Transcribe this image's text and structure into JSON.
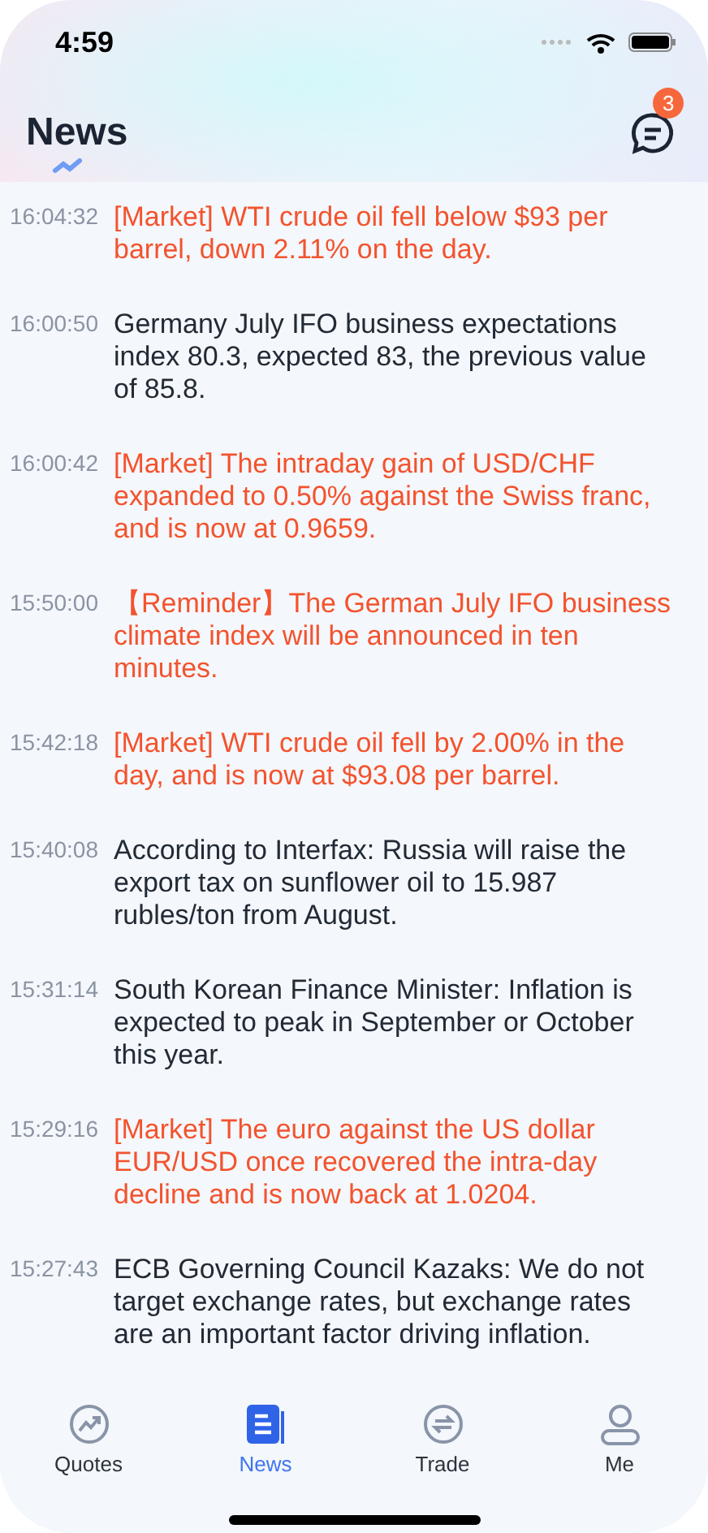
{
  "status_bar": {
    "time": "4:59"
  },
  "header": {
    "title": "News",
    "badge": "3"
  },
  "news": [
    {
      "time": "16:04:32",
      "text": "[Market] WTI crude oil fell below $93 per barrel, down 2.11% on the day.",
      "highlight": true
    },
    {
      "time": "16:00:50",
      "text": "Germany July IFO business expectations index 80.3, expected 83, the previous value of 85.8.",
      "highlight": false
    },
    {
      "time": "16:00:42",
      "text": "[Market] The intraday gain of USD/CHF expanded to 0.50% against the Swiss franc, and is now at 0.9659.",
      "highlight": true
    },
    {
      "time": "15:50:00",
      "text": "【Reminder】The German July IFO business climate index will be announced in ten minutes.",
      "highlight": true
    },
    {
      "time": "15:42:18",
      "text": "[Market] WTI crude oil fell by 2.00% in the day, and is now at $93.08 per barrel.",
      "highlight": true
    },
    {
      "time": "15:40:08",
      "text": "According to Interfax: Russia will raise the export tax on sunflower oil to 15.987 rubles/ton from August.",
      "highlight": false
    },
    {
      "time": "15:31:14",
      "text": "South Korean Finance Minister: Inflation is expected to peak in September or October this year.",
      "highlight": false
    },
    {
      "time": "15:29:16",
      "text": "[Market] The euro against the US dollar EUR/USD once recovered the intra-day decline and is now back at 1.0204.",
      "highlight": true
    },
    {
      "time": "15:27:43",
      "text": "ECB Governing Council Kazaks: We do not target exchange rates, but exchange rates are an important factor driving inflation.",
      "highlight": false
    }
  ],
  "tab_bar": [
    {
      "kind": "quotes",
      "label": "Quotes",
      "selected": false
    },
    {
      "kind": "news",
      "label": "News",
      "selected": true
    },
    {
      "kind": "trade",
      "label": "Trade",
      "selected": false
    },
    {
      "kind": "me",
      "label": "Me",
      "selected": false
    }
  ]
}
